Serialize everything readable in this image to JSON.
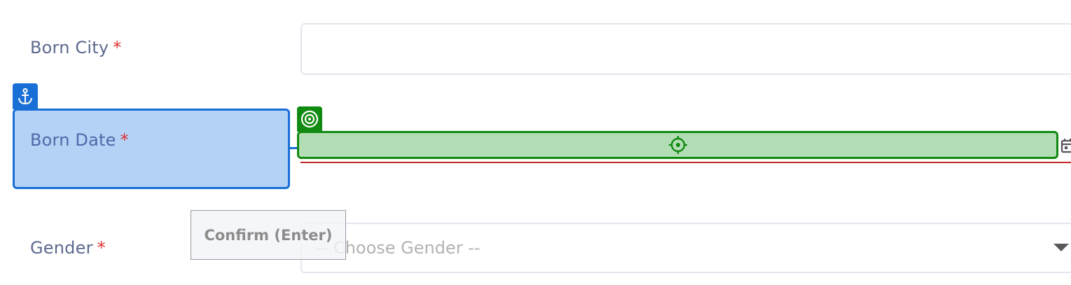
{
  "form": {
    "born_city": {
      "label": "Born City",
      "required_mark": "*",
      "value": ""
    },
    "born_date": {
      "label": "Born Date",
      "required_mark": "*",
      "value": ""
    },
    "gender": {
      "label": "Gender",
      "required_mark": "*",
      "selected": "-- Choose Gender --"
    }
  },
  "overlay": {
    "confirm_label": "Confirm (Enter)",
    "anchor_icon": "anchor-icon",
    "target_icon": "target-icon",
    "crosshair_icon": "crosshair-icon",
    "anchor_color": "#1a6fd6",
    "target_color": "#118a11"
  },
  "colors": {
    "label": "#5d6a8f",
    "required": "#e03131",
    "error_underline": "#c62828"
  }
}
